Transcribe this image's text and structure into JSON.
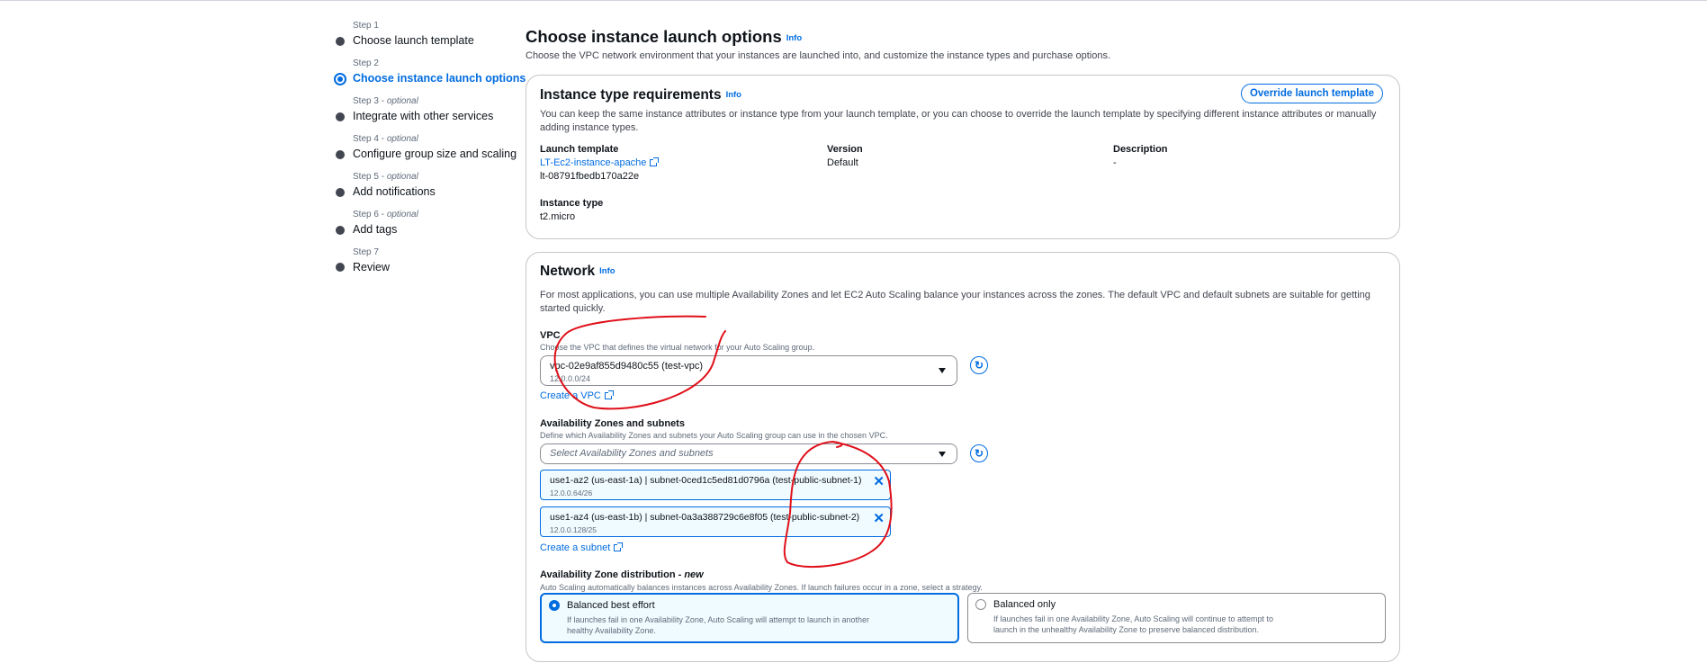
{
  "stepper": [
    {
      "number": "Step 1",
      "optional": "",
      "title": "Choose launch template"
    },
    {
      "number": "Step 2",
      "optional": "",
      "title": "Choose instance launch options"
    },
    {
      "number": "Step 3 - ",
      "optional": "optional",
      "title": "Integrate with other services"
    },
    {
      "number": "Step 4 - ",
      "optional": "optional",
      "title": "Configure group size and scaling"
    },
    {
      "number": "Step 5 - ",
      "optional": "optional",
      "title": "Add notifications"
    },
    {
      "number": "Step 6 - ",
      "optional": "optional",
      "title": "Add tags"
    },
    {
      "number": "Step 7",
      "optional": "",
      "title": "Review"
    }
  ],
  "page": {
    "title": "Choose instance launch options",
    "info": "Info",
    "subtitle": "Choose the VPC network environment that your instances are launched into, and customize the instance types and purchase options."
  },
  "instance_req": {
    "title": "Instance type requirements",
    "info": "Info",
    "override_button": "Override launch template",
    "description": "You can keep the same instance attributes or instance type from your launch template, or you can choose to override the launch template by specifying different instance attributes or manually adding instance types.",
    "launch_template_label": "Launch template",
    "launch_template_name": "LT-Ec2-instance-apache",
    "launch_template_id": "lt-08791fbedb170a22e",
    "version_label": "Version",
    "version_value": "Default",
    "description_label": "Description",
    "description_value": "-",
    "instance_type_label": "Instance type",
    "instance_type_value": "t2.micro"
  },
  "network": {
    "title": "Network",
    "info": "Info",
    "description": "For most applications, you can use multiple Availability Zones and let EC2 Auto Scaling balance your instances across the zones. The default VPC and default subnets are suitable for getting started quickly.",
    "vpc_label": "VPC",
    "vpc_hint": "Choose the VPC that defines the virtual network for your Auto Scaling group.",
    "vpc_value": "vpc-02e9af855d9480c55 (test-vpc)",
    "vpc_cidr": "12.0.0.0/24",
    "create_vpc": "Create a VPC",
    "az_label": "Availability Zones and subnets",
    "az_hint": "Define which Availability Zones and subnets your Auto Scaling group can use in the chosen VPC.",
    "az_placeholder": "Select Availability Zones and subnets",
    "subnets": [
      {
        "label": "use1-az2 (us-east-1a) | subnet-0ced1c5ed81d0796a (test-public-subnet-1)",
        "cidr": "12.0.0.64/26"
      },
      {
        "label": "use1-az4 (us-east-1b) | subnet-0a3a388729c6e8f05 (test-public-subnet-2)",
        "cidr": "12.0.0.128/25"
      }
    ],
    "create_subnet": "Create a subnet",
    "dist_label": "Availability Zone distribution - ",
    "dist_label_new": "new",
    "dist_hint": "Auto Scaling automatically balances instances across Availability Zones. If launch failures occur in a zone, select a strategy.",
    "options": [
      {
        "title": "Balanced best effort",
        "desc": "If launches fail in one Availability Zone, Auto Scaling will attempt to launch in another healthy Availability Zone.",
        "selected": true
      },
      {
        "title": "Balanced only",
        "desc": "If launches fail in one Availability Zone, Auto Scaling will continue to attempt to launch in the unhealthy Availability Zone to preserve balanced distribution.",
        "selected": false
      }
    ]
  },
  "colors": {
    "accent": "#006ce0",
    "annotation": "#e0101a",
    "border": "#c6c6cd"
  }
}
